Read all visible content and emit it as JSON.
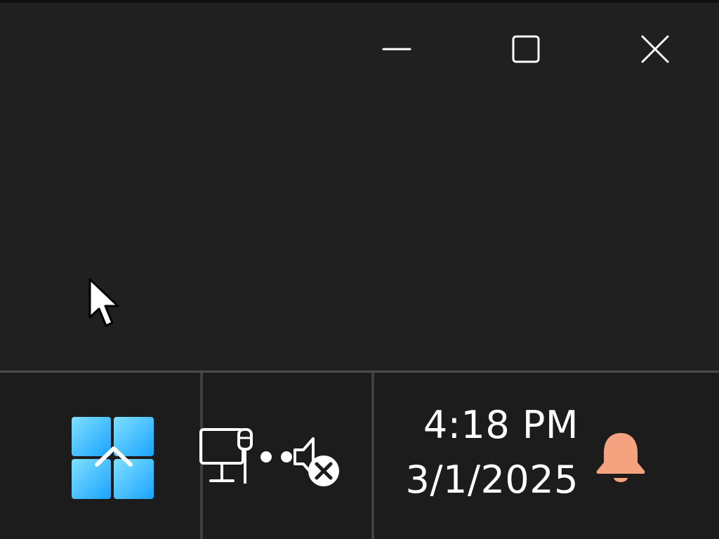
{
  "window": {
    "controls": {
      "minimize_icon": "minimize-icon",
      "maximize_icon": "maximize-icon",
      "close_icon": "close-icon"
    }
  },
  "cursor": {
    "icon": "mouse-pointer-icon"
  },
  "taskbar": {
    "start_button": {
      "icon": "windows-start-icon",
      "accent_colors": [
        "#7fe0ff",
        "#1aa3ff"
      ]
    },
    "tray": {
      "network_icon": "network-wired-icon",
      "volume_icon": "volume-muted-icon"
    },
    "clock": {
      "time": "4:18 PM",
      "date": "3/1/2025"
    },
    "notifications": {
      "icon": "bell-icon",
      "color": "#f4a27f"
    }
  },
  "colors": {
    "background": "#202020",
    "taskbar": "#1c1c1c",
    "text": "#ffffff"
  }
}
